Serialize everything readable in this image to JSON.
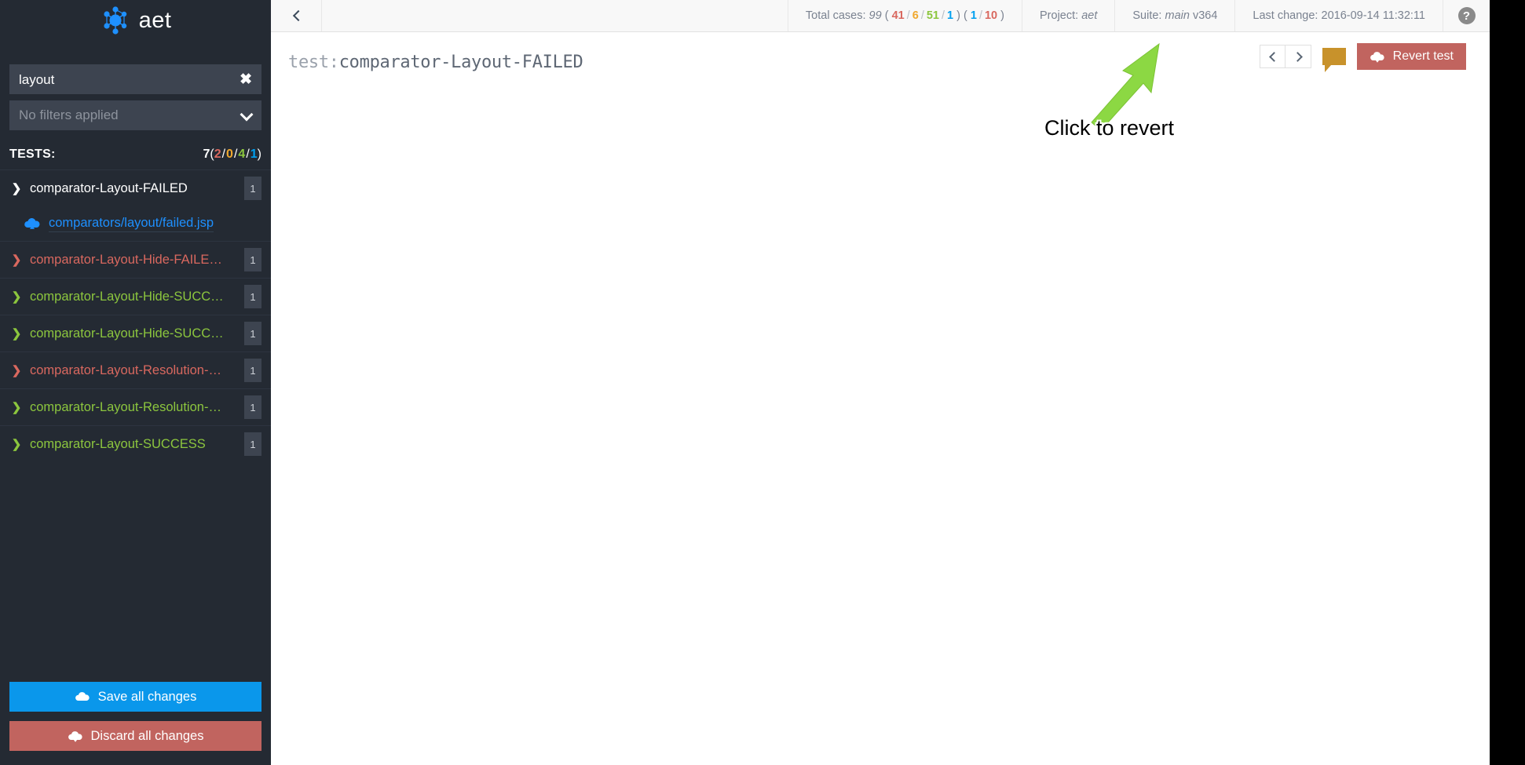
{
  "app": {
    "name": "aet",
    "logo_icon": "aet-molecule-logo"
  },
  "sidebar": {
    "search": {
      "value": "layout",
      "clear_icon": "close-x-icon"
    },
    "filter": {
      "label": "No filters applied",
      "chevron_icon": "chevron-down-icon"
    },
    "tests_header": {
      "title": "TESTS:",
      "total": "7",
      "open_paren": "(",
      "failed": "2",
      "warning": "0",
      "passed": "4",
      "info": "1",
      "close_paren": ")",
      "separator": "/"
    },
    "tests": [
      {
        "name": "comparator-Layout-FAILED",
        "count": "1",
        "status": "selected",
        "expanded": true,
        "child": {
          "label": "comparators/layout/failed.jsp",
          "icon": "cloud-upload-icon"
        }
      },
      {
        "name": "comparator-Layout-Hide-FAILE…",
        "count": "1",
        "status": "failed",
        "expanded": false
      },
      {
        "name": "comparator-Layout-Hide-SUCC…",
        "count": "1",
        "status": "passed",
        "expanded": false
      },
      {
        "name": "comparator-Layout-Hide-SUCC…",
        "count": "1",
        "status": "passed",
        "expanded": false
      },
      {
        "name": "comparator-Layout-Resolution-…",
        "count": "1",
        "status": "failed",
        "expanded": false
      },
      {
        "name": "comparator-Layout-Resolution-…",
        "count": "1",
        "status": "passed",
        "expanded": false
      },
      {
        "name": "comparator-Layout-SUCCESS",
        "count": "1",
        "status": "passed",
        "expanded": false
      }
    ],
    "actions": {
      "save_label": "Save all changes",
      "save_icon": "cloud-upload-icon",
      "discard_label": "Discard all changes",
      "discard_icon": "cloud-download-icon"
    }
  },
  "topbar": {
    "collapse_icon": "chevron-left-icon",
    "total_cases": {
      "label": "Total cases:",
      "total": "99",
      "open_paren": "(",
      "failed": "41",
      "warning": "6",
      "passed": "51",
      "info": "1",
      "close_paren": ")",
      "open_paren2": "(",
      "rerun": "1",
      "rerun_total": "10",
      "close_paren2": ")",
      "separator": "/"
    },
    "project": {
      "label": "Project:",
      "value": "aet"
    },
    "suite": {
      "label": "Suite:",
      "value": "main",
      "version": "v364"
    },
    "last_change": {
      "label": "Last change:",
      "value": "2016-09-14 11:32:11"
    },
    "help_icon": "question-mark-icon",
    "help_glyph": "?"
  },
  "content": {
    "title_prefix": "test:",
    "title_value": "comparator-Layout-FAILED",
    "prev_icon": "chevron-left-icon",
    "next_icon": "chevron-right-icon",
    "comment_icon": "comment-bubble-icon",
    "revert_label": "Revert test",
    "revert_icon": "cloud-download-icon"
  },
  "annotation": {
    "text": "Click to revert",
    "arrow_icon": "green-arrow-icon",
    "arrow_color": "#8cd843"
  },
  "colors": {
    "accent_blue": "#0a97eb",
    "failed_red": "#d9685f",
    "warning_orange": "#f0a82e",
    "passed_green": "#8cc63e",
    "info_blue": "#00a0f0",
    "sidebar_bg": "#242a33",
    "revert_red": "#c1645f",
    "comment_gold": "#c8922b"
  }
}
